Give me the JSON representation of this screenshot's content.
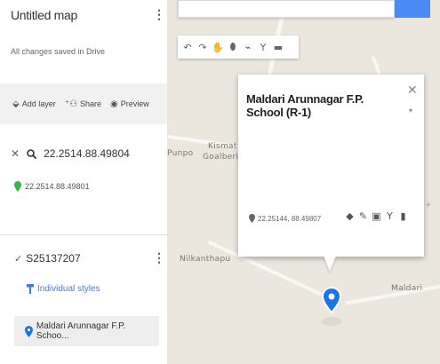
{
  "panel": {
    "title": "Untitled map",
    "save_status": "All changes saved in Drive",
    "actions": [
      {
        "label": "Add layer",
        "icon": "add-layer-icon"
      },
      {
        "label": "Share",
        "icon": "share-icon"
      },
      {
        "label": "Preview",
        "icon": "preview-icon"
      }
    ],
    "search_query": "22.2514.88.49804",
    "search_result": "22.2514.88.49801",
    "layer": {
      "name": "S25137207",
      "checked": true,
      "style_label": "Individual styles",
      "item_label": "Maldari Arunnagar F.P. Schoo..."
    }
  },
  "map": {
    "places": [
      "Kismat",
      "Goalberia",
      "Punpo",
      "Nilkanthapu",
      "Maldari"
    ],
    "tools": [
      "undo-icon",
      "redo-icon",
      "hand-icon",
      "marker-icon",
      "line-icon",
      "filter-icon",
      "ruler-icon"
    ]
  },
  "popup": {
    "title": "Maldari Arunnagar F.P. School (R-1)",
    "coords": "22.25144, 88.49807",
    "actions": [
      "paint-icon",
      "edit-icon",
      "camera-icon",
      "directions-icon",
      "delete-icon"
    ]
  },
  "colors": {
    "accent": "#4a8af4",
    "marker": "#1a73e8",
    "pin_green": "#3bb54a",
    "map_bg": "#ebe7df"
  }
}
